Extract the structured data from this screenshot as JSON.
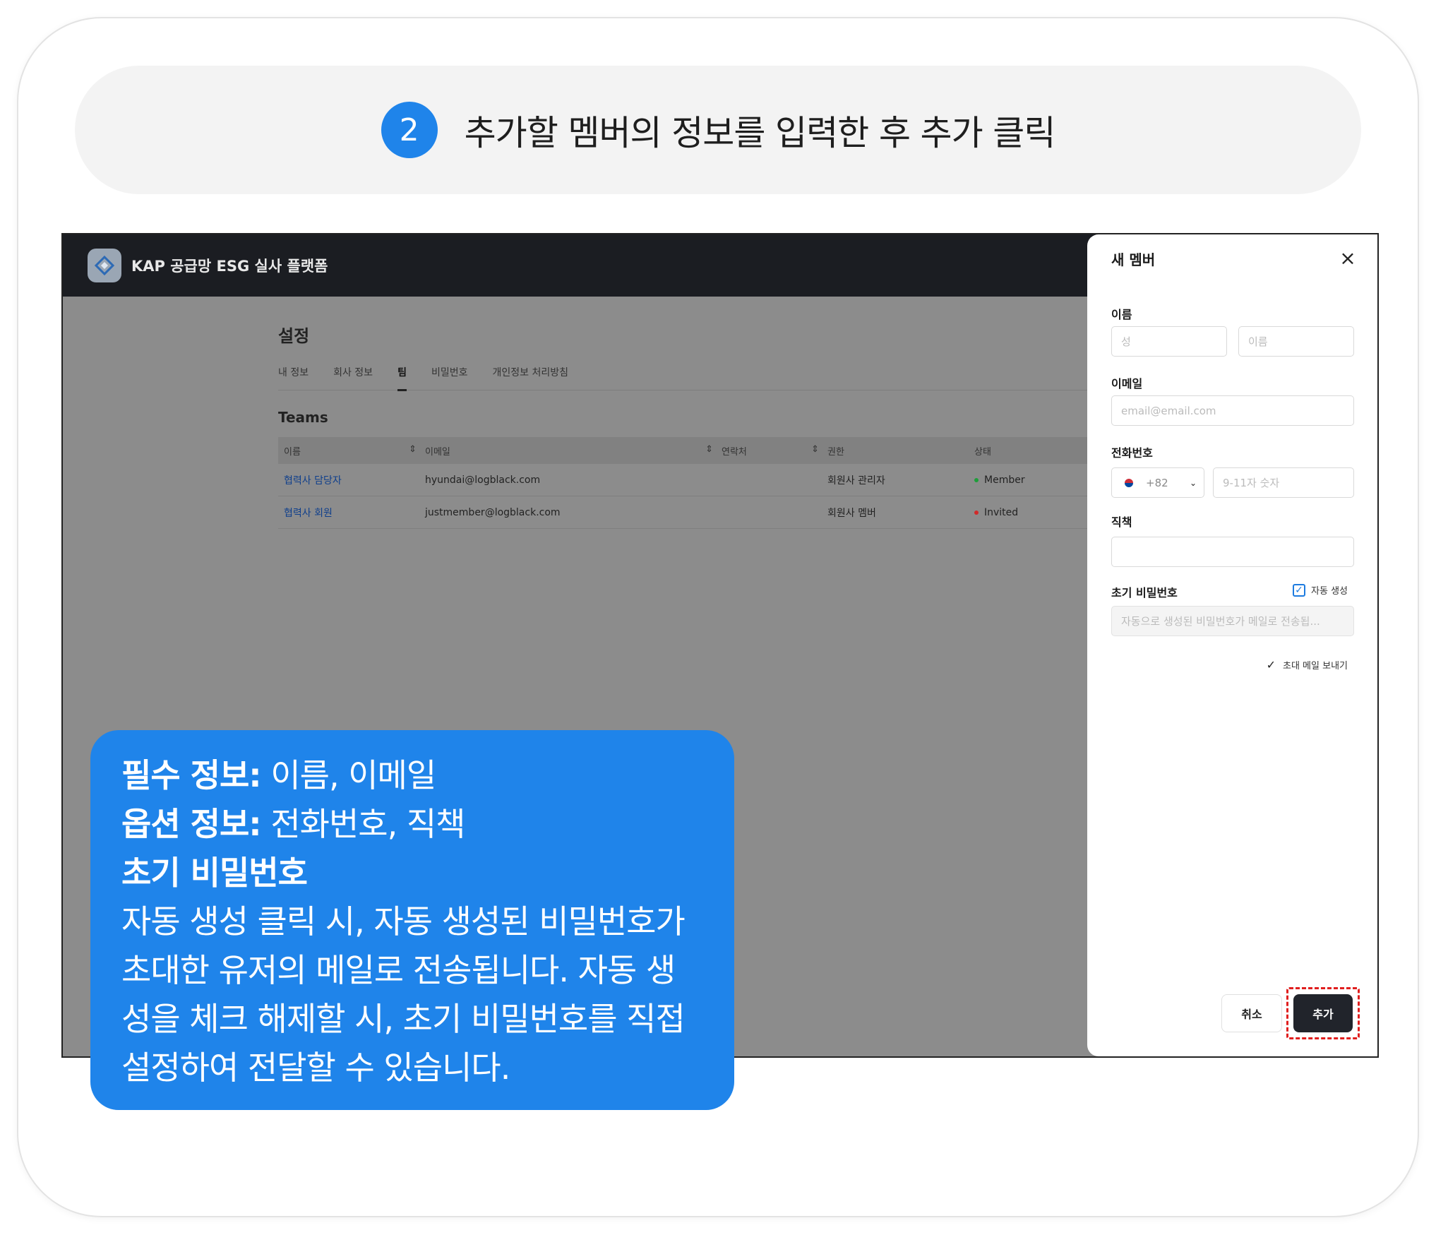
{
  "header": {
    "step_number": "2",
    "title": "추가할 멤버의 정보를 입력한 후 추가 클릭"
  },
  "app": {
    "title": "KAP 공급망 ESG 실사 플랫폼",
    "page_title": "설정",
    "tabs": [
      "내 정보",
      "회사 정보",
      "팀",
      "비밀번호",
      "개인정보 처리방침"
    ],
    "active_tab": "팀",
    "section_title": "Teams",
    "table": {
      "headers": [
        "이름",
        "이메일",
        "연락처",
        "권한",
        "상태"
      ],
      "rows": [
        {
          "name": "협력사 담당자",
          "email": "hyundai@logblack.com",
          "phone": "",
          "role": "회원사 관리자",
          "status": "Member",
          "status_color": "#1e9e3a"
        },
        {
          "name": "협력사 회원",
          "email": "justmember@logblack.com",
          "phone": "",
          "role": "회원사 멤버",
          "status": "Invited",
          "status_color": "#d12a2a"
        }
      ]
    }
  },
  "panel": {
    "title": "새 멤버",
    "name_label": "이름",
    "last_name_placeholder": "성",
    "first_name_placeholder": "이름",
    "email_label": "이메일",
    "email_placeholder": "email@email.com",
    "phone_label": "전화번호",
    "country_code": "+82",
    "phone_placeholder": "9-11자 숫자",
    "position_label": "직책",
    "position_value": "",
    "password_label": "초기 비밀번호",
    "auto_generate_label": "자동 생성",
    "password_placeholder": "자동으로 생성된 비밀번호가 메일로 전송됩...",
    "send_invite_label": "초대 메일 보내기",
    "cancel_label": "취소",
    "add_label": "추가"
  },
  "callout": {
    "required_label": "필수 정보:",
    "required_text": " 이름, 이메일",
    "optional_label": "옵션 정보:",
    "optional_text": " 전화번호, 직책",
    "password_heading": "초기 비밀번호",
    "password_lines": [
      "자동 생성 클릭 시, 자동 생성된 비밀번호가",
      "초대한 유저의 메일로 전송됩니다. 자동 생",
      "성을 체크 해제할 시, 초기 비밀번호를 직접",
      "설정하여 전달할 수 있습니다."
    ]
  },
  "colors": {
    "accent_blue": "#1f84ea",
    "highlight_red": "#e01e1e",
    "dark_button": "#21242b"
  }
}
